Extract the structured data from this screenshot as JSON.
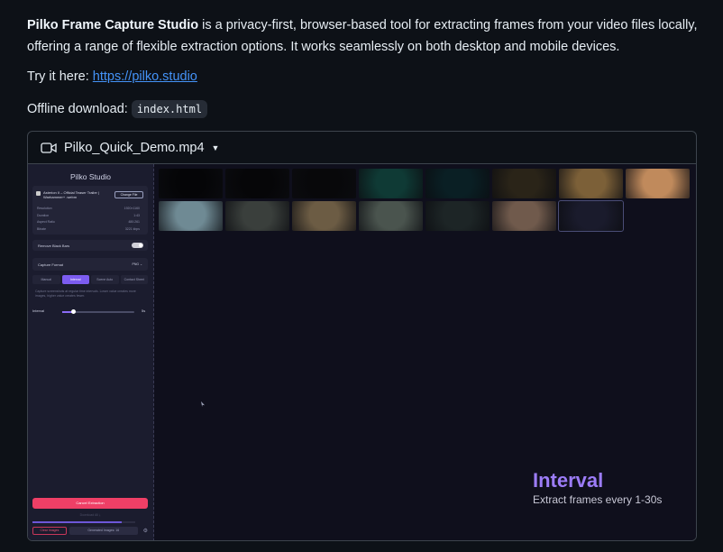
{
  "intro": {
    "title_bold": "Pilko Frame Capture Studio",
    "line1_rest": " is a privacy-first, browser-based tool for extracting frames from your video files locally,",
    "line2": "offering a range of flexible extraction options. It works seamlessly on both desktop and mobile devices."
  },
  "try": {
    "label": "Try it here: ",
    "link": "https://pilko.studio"
  },
  "offline": {
    "label": "Offline download: ",
    "code": "index.html"
  },
  "video": {
    "filename": "Pilko_Quick_Demo.mp4",
    "icon": "video-camera-icon"
  },
  "app": {
    "title": "Pilko Studio",
    "file": {
      "name": "Asterion II – Official Teaser Trailer | Warhammer+ .webm",
      "change_label": "Change File",
      "rows": [
        {
          "k": "Resolution",
          "v": "1920×1160"
        },
        {
          "k": "Duration",
          "v": "1:43"
        },
        {
          "k": "Aspect Ratio",
          "v": "480:261"
        },
        {
          "k": "Bitrate",
          "v": "3221 kbps"
        }
      ]
    },
    "remove_black_bars": {
      "label": "Remove Black Bars",
      "enabled": true
    },
    "capture_format": {
      "label": "Capture Format",
      "value": "PNG"
    },
    "tabs": [
      "Manual",
      "Interval",
      "Scene Auto",
      "Contact Sheet"
    ],
    "active_tab": 1,
    "description": "Capture screenshots at regular time intervals. Lower value creates more images, higher value creates fewer.",
    "interval": {
      "label": "Interval",
      "value_label": "5s",
      "fraction": 0.15
    },
    "cancel_label": "Cancel Extraction",
    "download_label": "Download All",
    "progress_fraction": 0.87,
    "clear_label": "Clear Images",
    "count_label": "Generated Images: 16"
  },
  "thumbnails": [
    "#050507",
    "#060608",
    "#08080a",
    "#0f3a35",
    "#0a1f24",
    "#2a2418",
    "#7c6038",
    "#c08a5c",
    "#6f8a94",
    "#3a3f3c",
    "#6c5c44",
    "#4a544e",
    "#1d2526",
    "#705a4c",
    "#1a1b2c"
  ],
  "overlay": {
    "title": "Interval",
    "subtitle": "Extract frames every 1-30s"
  }
}
